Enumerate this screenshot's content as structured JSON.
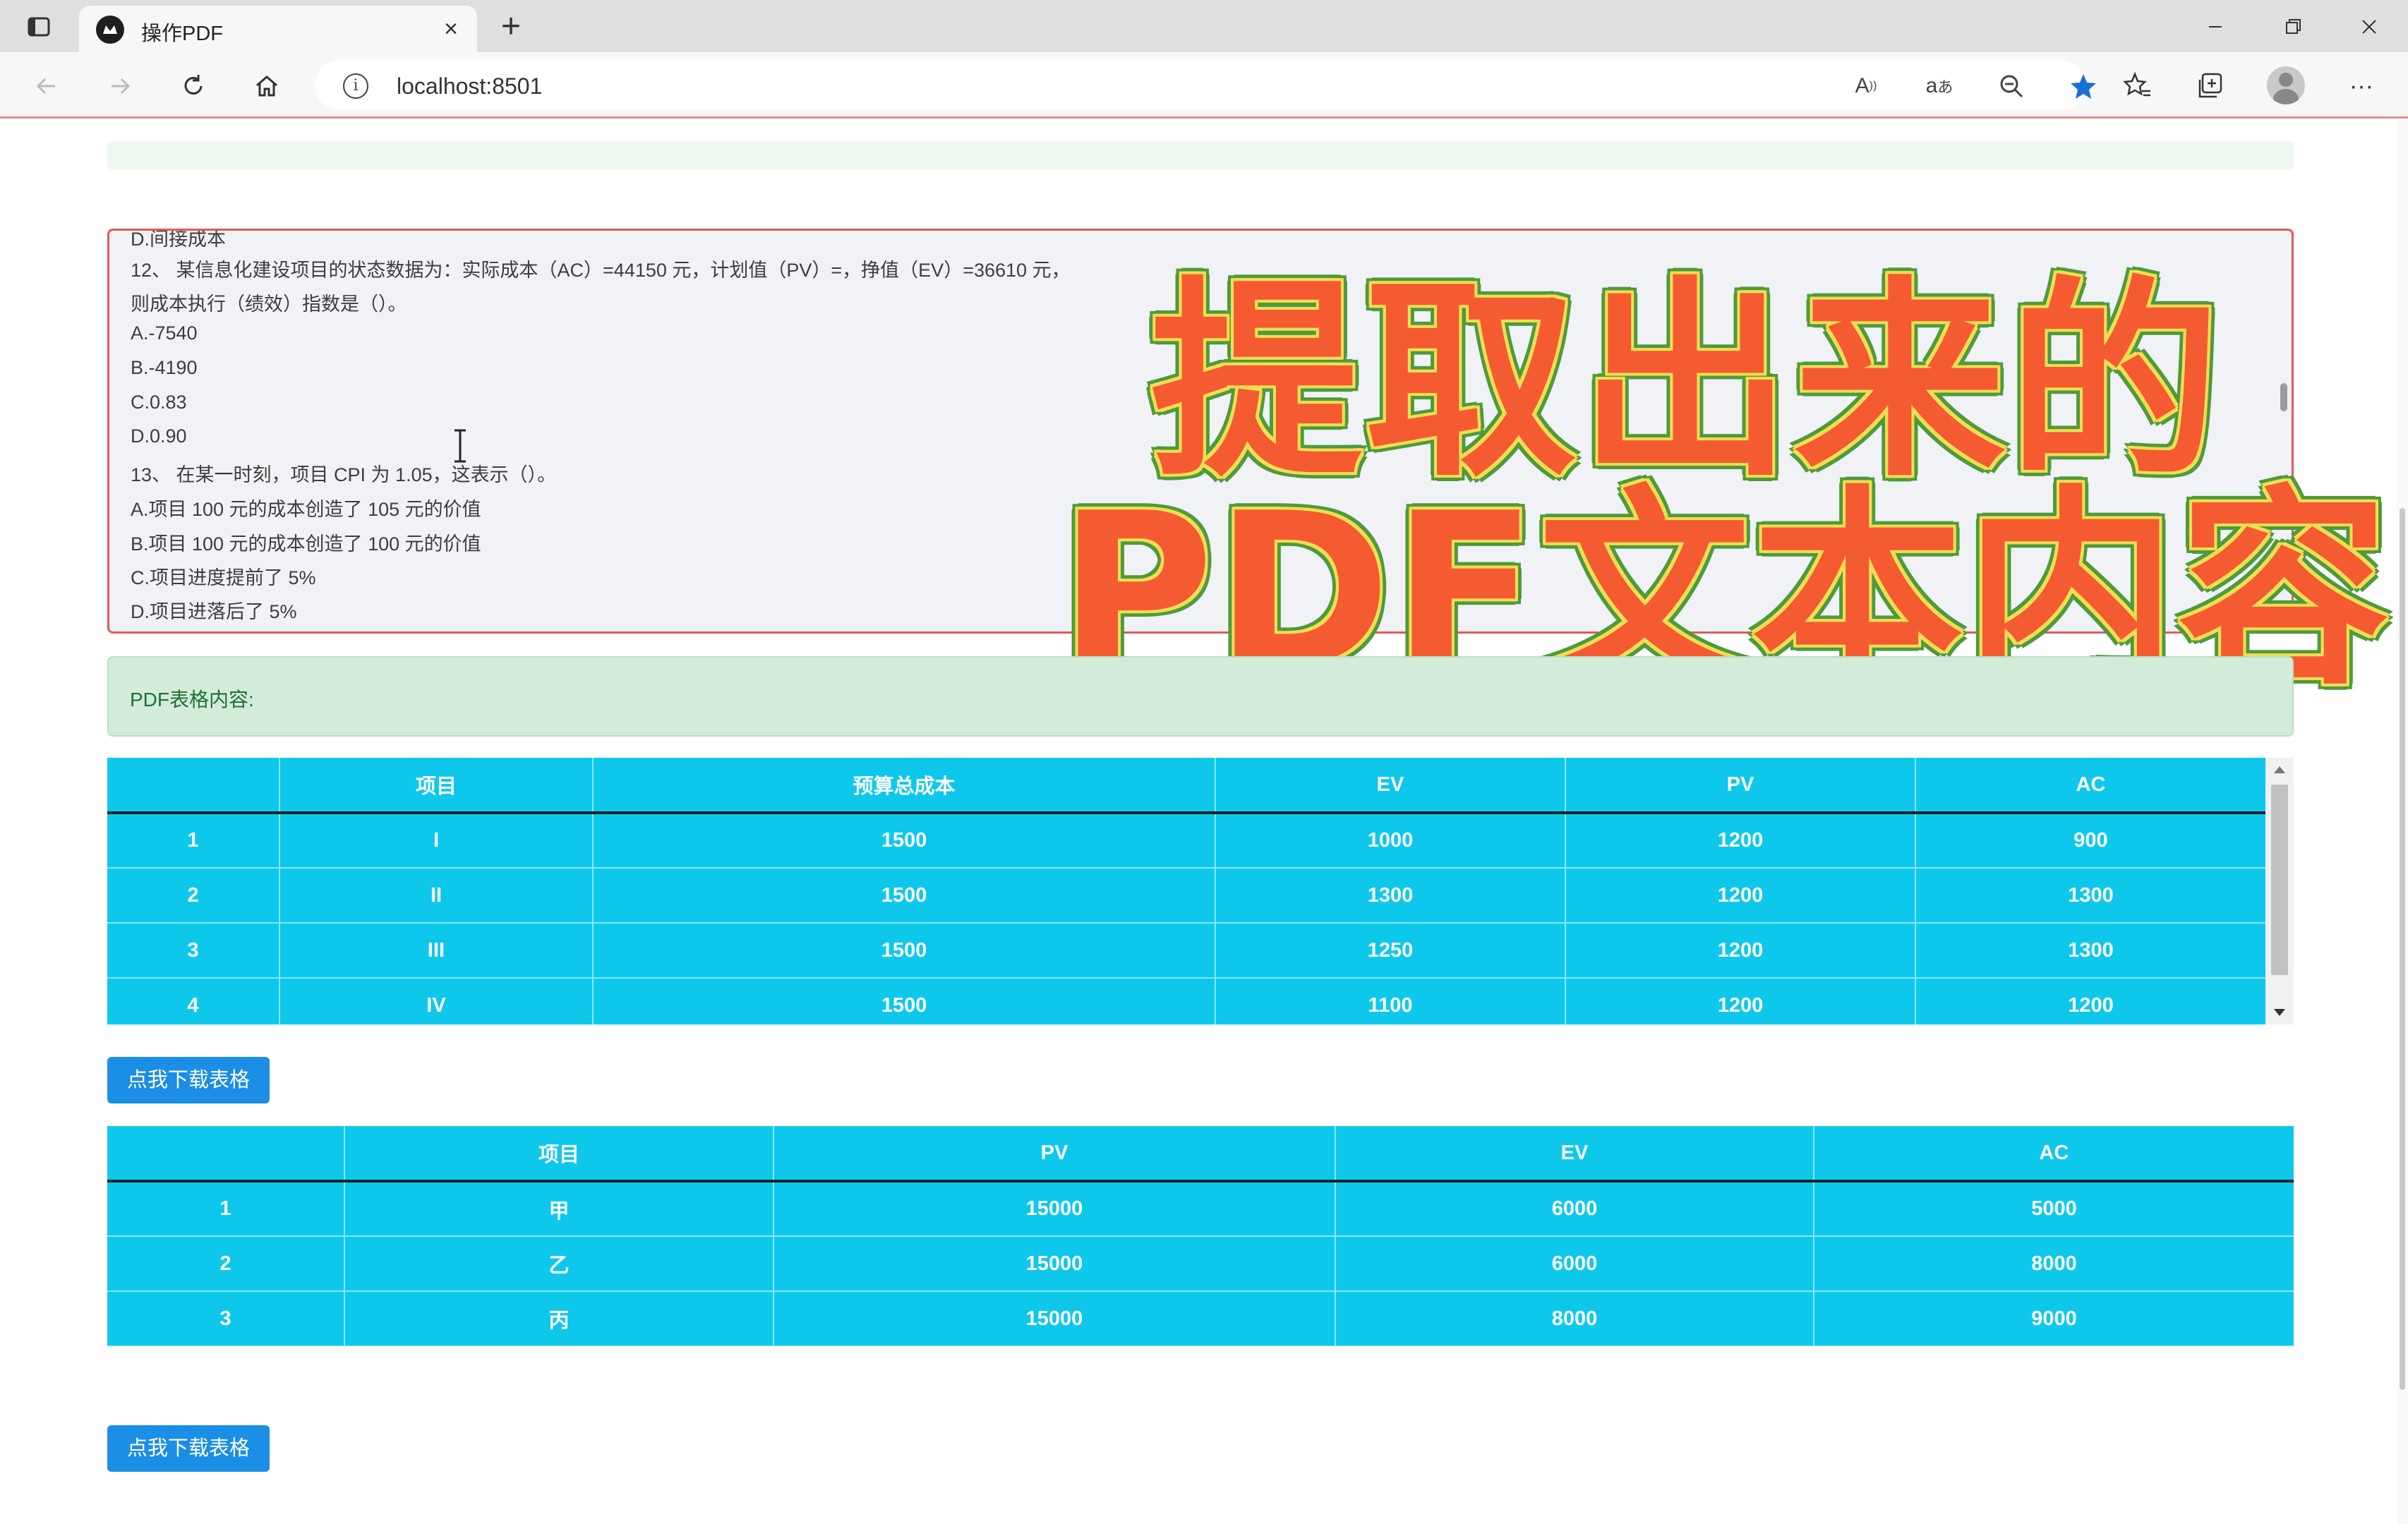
{
  "browser": {
    "tab_title": "操作PDF",
    "url": "localhost:8501"
  },
  "textarea": {
    "lines": [
      "D.间接成本",
      "12、 某信息化建设项目的状态数据为：实际成本（AC）=44150 元，计划值（PV）=，挣值（EV）=36610 元，",
      "则成本执行（绩效）指数是（）。",
      "A.-7540",
      "B.-4190",
      "C.0.83",
      "D.0.90",
      "13、 在某一时刻，项目 CPI 为 1.05，这表示（）。",
      "A.项目 100 元的成本创造了 105 元的价值",
      "B.项目 100 元的成本创造了 100 元的价值",
      "C.项目进度提前了 5%",
      "D.项目进落后了 5%"
    ]
  },
  "overlay": {
    "line1": "提取出来的",
    "line2": "PDF文本内容"
  },
  "alert": {
    "text": "PDF表格内容:"
  },
  "table1": {
    "headers": [
      "",
      "项目",
      "预算总成本",
      "EV",
      "PV",
      "AC"
    ],
    "rows": [
      [
        "1",
        "I",
        "1500",
        "1000",
        "1200",
        "900"
      ],
      [
        "2",
        "II",
        "1500",
        "1300",
        "1200",
        "1300"
      ],
      [
        "3",
        "III",
        "1500",
        "1250",
        "1200",
        "1300"
      ],
      [
        "4",
        "IV",
        "1500",
        "1100",
        "1200",
        "1200"
      ]
    ]
  },
  "table2": {
    "headers": [
      "",
      "项目",
      "PV",
      "EV",
      "AC"
    ],
    "rows": [
      [
        "1",
        "甲",
        "15000",
        "6000",
        "5000"
      ],
      [
        "2",
        "乙",
        "15000",
        "6000",
        "8000"
      ],
      [
        "3",
        "丙",
        "15000",
        "8000",
        "9000"
      ]
    ]
  },
  "buttons": {
    "download1": "点我下载表格",
    "download2": "点我下载表格"
  },
  "colors": {
    "table_bg": "#0ec8ec",
    "button": "#1b8ee6",
    "alert_bg": "#d3ecda",
    "textarea_border": "#e05a5a",
    "overlay_fill": "#f45b31"
  }
}
